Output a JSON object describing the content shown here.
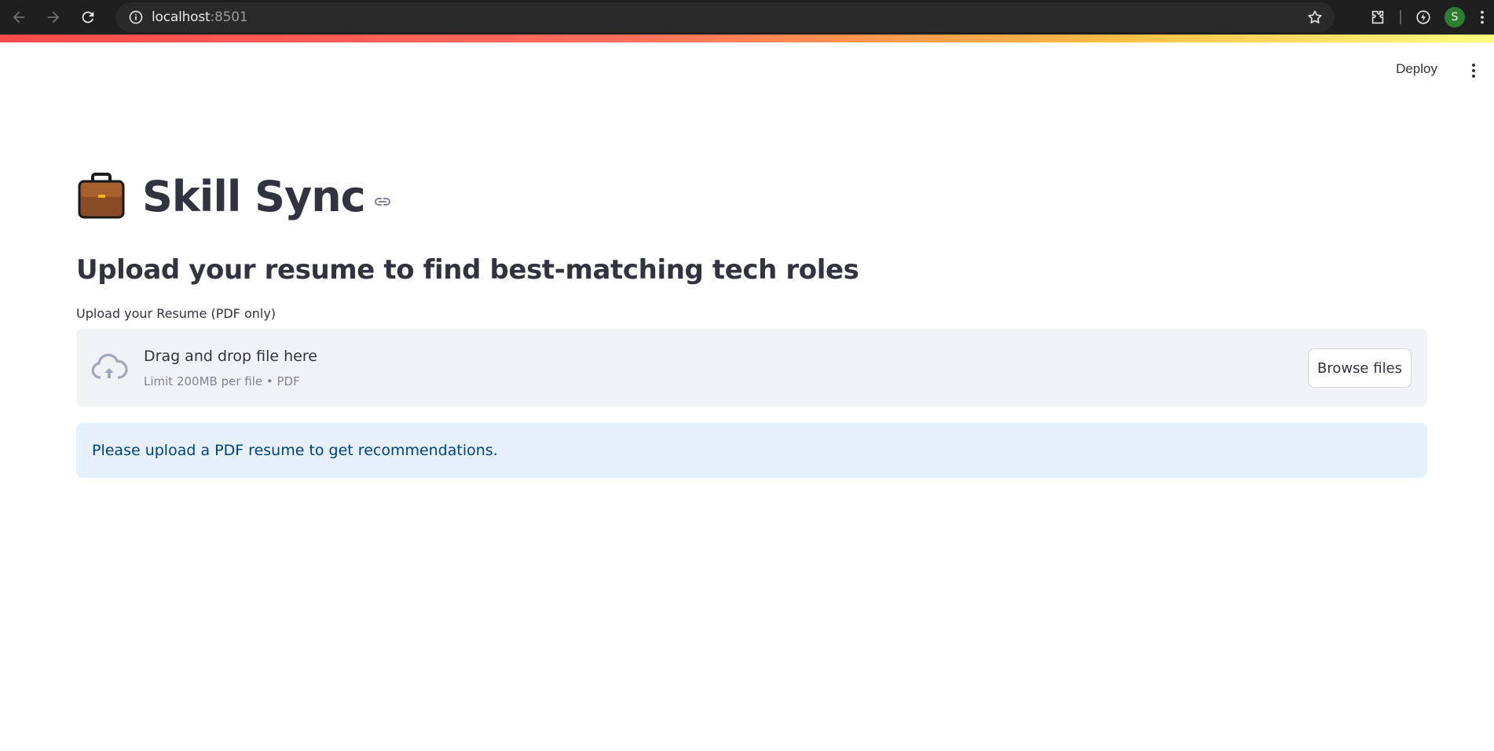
{
  "browser": {
    "url_host": "localhost",
    "url_port": ":8501",
    "avatar_letter": "S"
  },
  "header": {
    "deploy_label": "Deploy"
  },
  "app": {
    "title": "Skill Sync",
    "title_icon": "briefcase-icon",
    "subtitle": "Upload your resume to find best-matching tech roles",
    "uploader": {
      "label": "Upload your Resume (PDF only)",
      "drop_text": "Drag and drop file here",
      "limit_text": "Limit 200MB per file • PDF",
      "browse_label": "Browse files"
    },
    "info_message": "Please upload a PDF resume to get recommendations."
  },
  "colors": {
    "accent": "#ff4b4b",
    "info_bg": "#e5f0fb",
    "info_text": "#004280",
    "dropzone_bg": "#f0f2f6"
  }
}
